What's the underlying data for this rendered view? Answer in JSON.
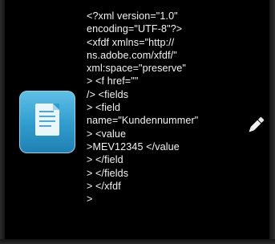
{
  "icons": {
    "document": "document-icon",
    "edit": "pencil-icon"
  },
  "colors": {
    "background": "#000000",
    "text": "#f4f4f4",
    "icon_accent": "#2f9ccd"
  },
  "code_lines": [
    "<?xml version=\"1.0\"",
    "encoding=\"UTF-8\"?>",
    "<xfdf xmlns=\"http://",
    "ns.adobe.com/xfdf/\"",
    "xml:space=\"preserve\"",
    "> <f href=\"\"",
    "/> <fields",
    "> <field",
    "name=\"Kundennummer\"",
    "> <value",
    ">MEV12345 </value",
    "> </field",
    "> </fields",
    "> </xfdf",
    ">"
  ]
}
